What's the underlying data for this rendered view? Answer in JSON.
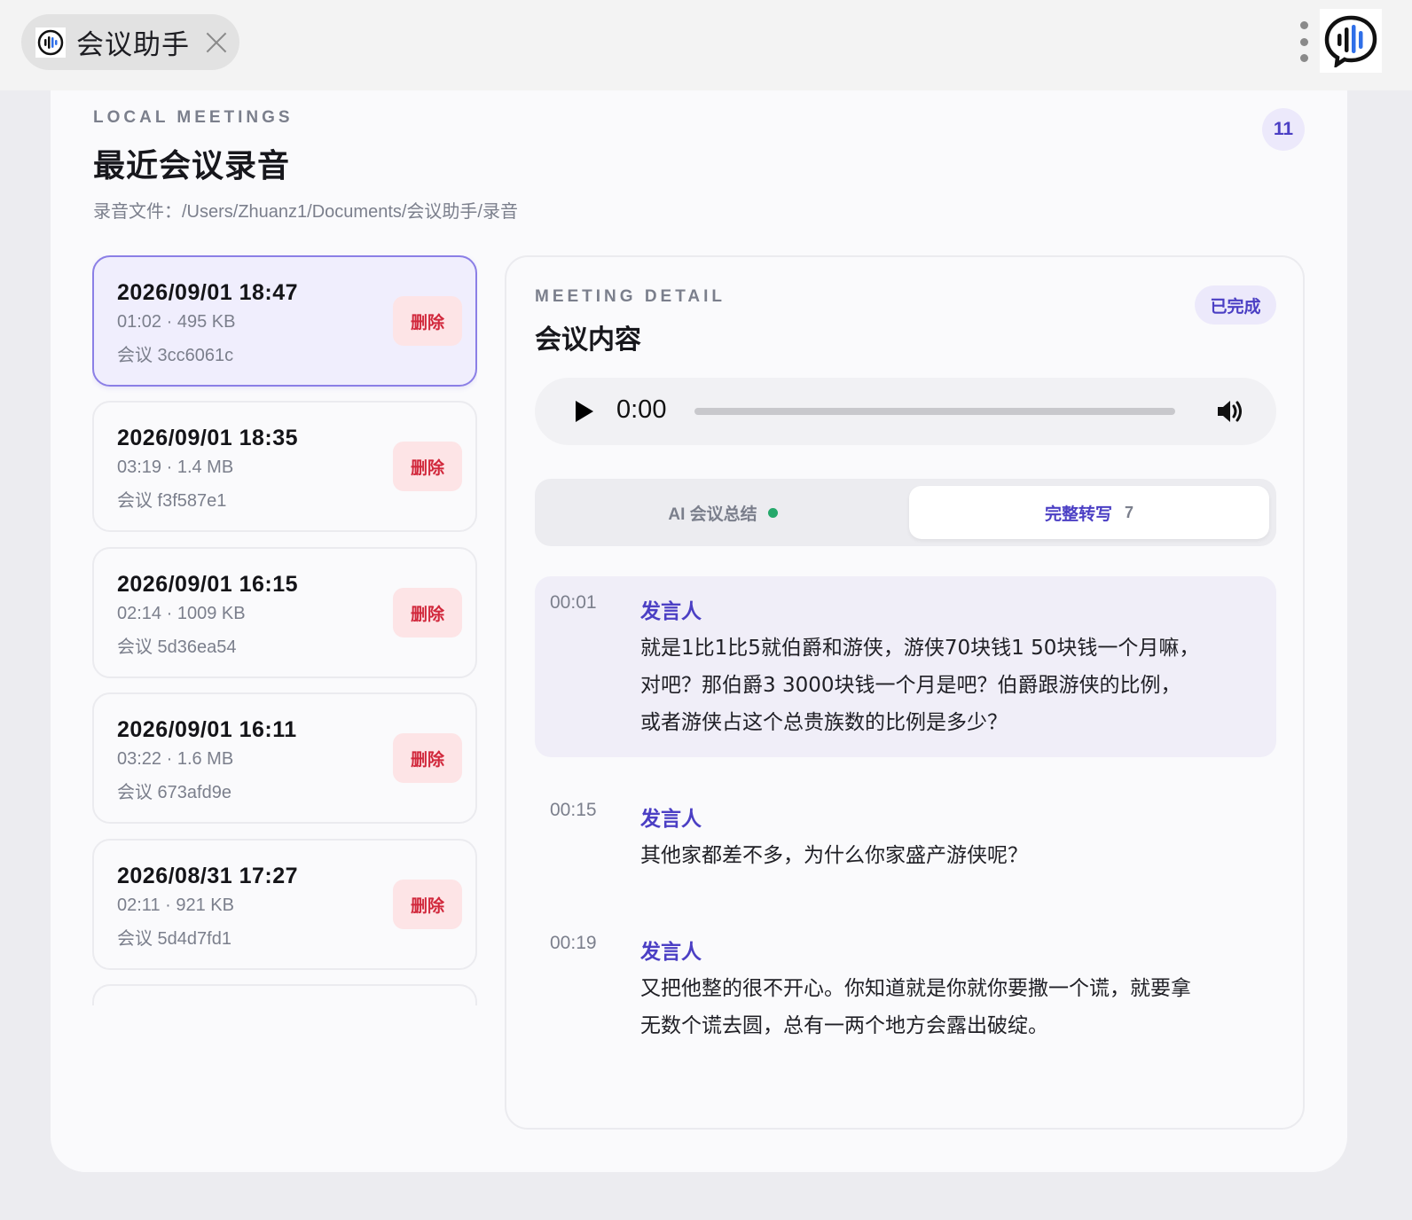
{
  "window": {
    "tab_title": "会议助手"
  },
  "header": {
    "eyebrow": "LOCAL MEETINGS",
    "title": "最近会议录音",
    "path_label": "录音文件：/Users/Zhuanz1/Documents/会议助手/录音",
    "count": "11"
  },
  "meetings": [
    {
      "date": "2026/09/01 18:47",
      "meta": "01:02 · 495 KB",
      "id": "会议 3cc6061c",
      "delete": "删除",
      "active": true
    },
    {
      "date": "2026/09/01 18:35",
      "meta": "03:19 · 1.4 MB",
      "id": "会议 f3f587e1",
      "delete": "删除",
      "active": false
    },
    {
      "date": "2026/09/01 16:15",
      "meta": "02:14 · 1009 KB",
      "id": "会议 5d36ea54",
      "delete": "删除",
      "active": false
    },
    {
      "date": "2026/09/01 16:11",
      "meta": "03:22 · 1.6 MB",
      "id": "会议 673afd9e",
      "delete": "删除",
      "active": false
    },
    {
      "date": "2026/08/31 17:27",
      "meta": "02:11 · 921 KB",
      "id": "会议 5d4d7fd1",
      "delete": "删除",
      "active": false
    }
  ],
  "detail": {
    "eyebrow": "MEETING DETAIL",
    "title": "会议内容",
    "status": "已完成",
    "player": {
      "time": "0:00",
      "progress": 0
    },
    "tabs": {
      "summary_label": "AI 会议总结",
      "full_label": "完整转写",
      "full_count": "7"
    },
    "transcript": [
      {
        "time": "00:01",
        "speaker": "发言人",
        "lines": [
          "就是1比1比5就伯爵和游侠，游侠70块钱1 50块钱一个月嘛，",
          "对吧？那伯爵3 3000块钱一个月是吧？伯爵跟游侠的比例，",
          "或者游侠占这个总贵族数的比例是多少？"
        ]
      },
      {
        "time": "00:15",
        "speaker": "发言人",
        "lines": [
          "其他家都差不多，为什么你家盛产游侠呢？"
        ]
      },
      {
        "time": "00:19",
        "speaker": "发言人",
        "lines": [
          "又把他整的很不开心。你知道就是你就你要撒一个谎，就要拿",
          "无数个谎去圆，总有一两个地方会露出破绽。"
        ]
      }
    ]
  },
  "colors": {
    "accent": "#4b3fc4",
    "danger": "#d1283c",
    "success": "#25a86b"
  }
}
